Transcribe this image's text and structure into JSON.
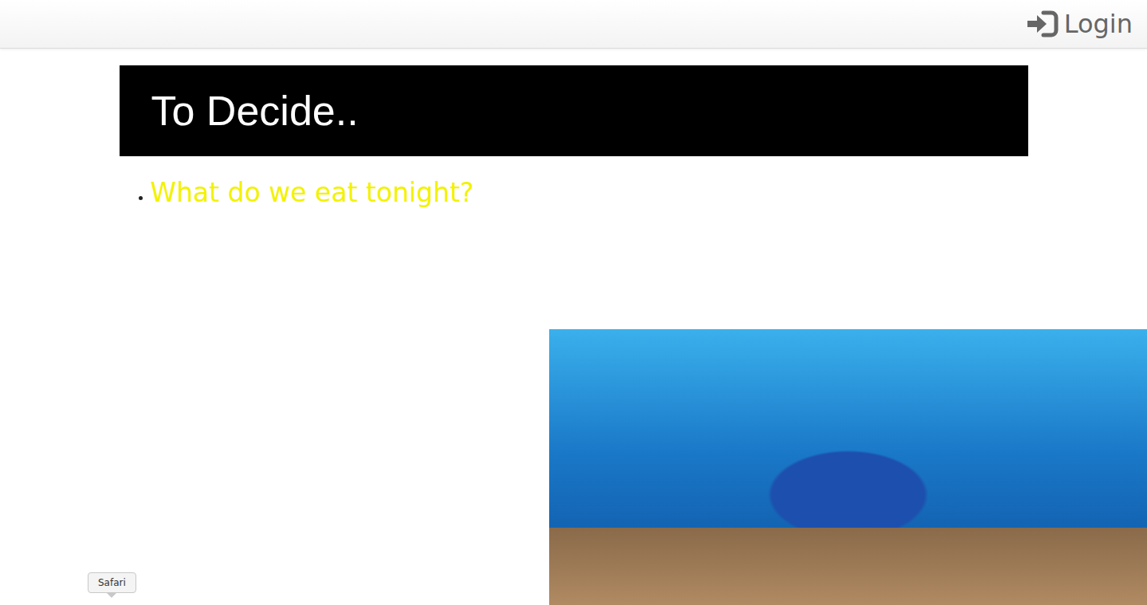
{
  "header": {
    "login": "Login"
  },
  "banner": {
    "title": "To Decide.."
  },
  "list": [
    {
      "text": "What do we eat tonight?"
    }
  ],
  "tooltip": {
    "label": "Safari"
  }
}
